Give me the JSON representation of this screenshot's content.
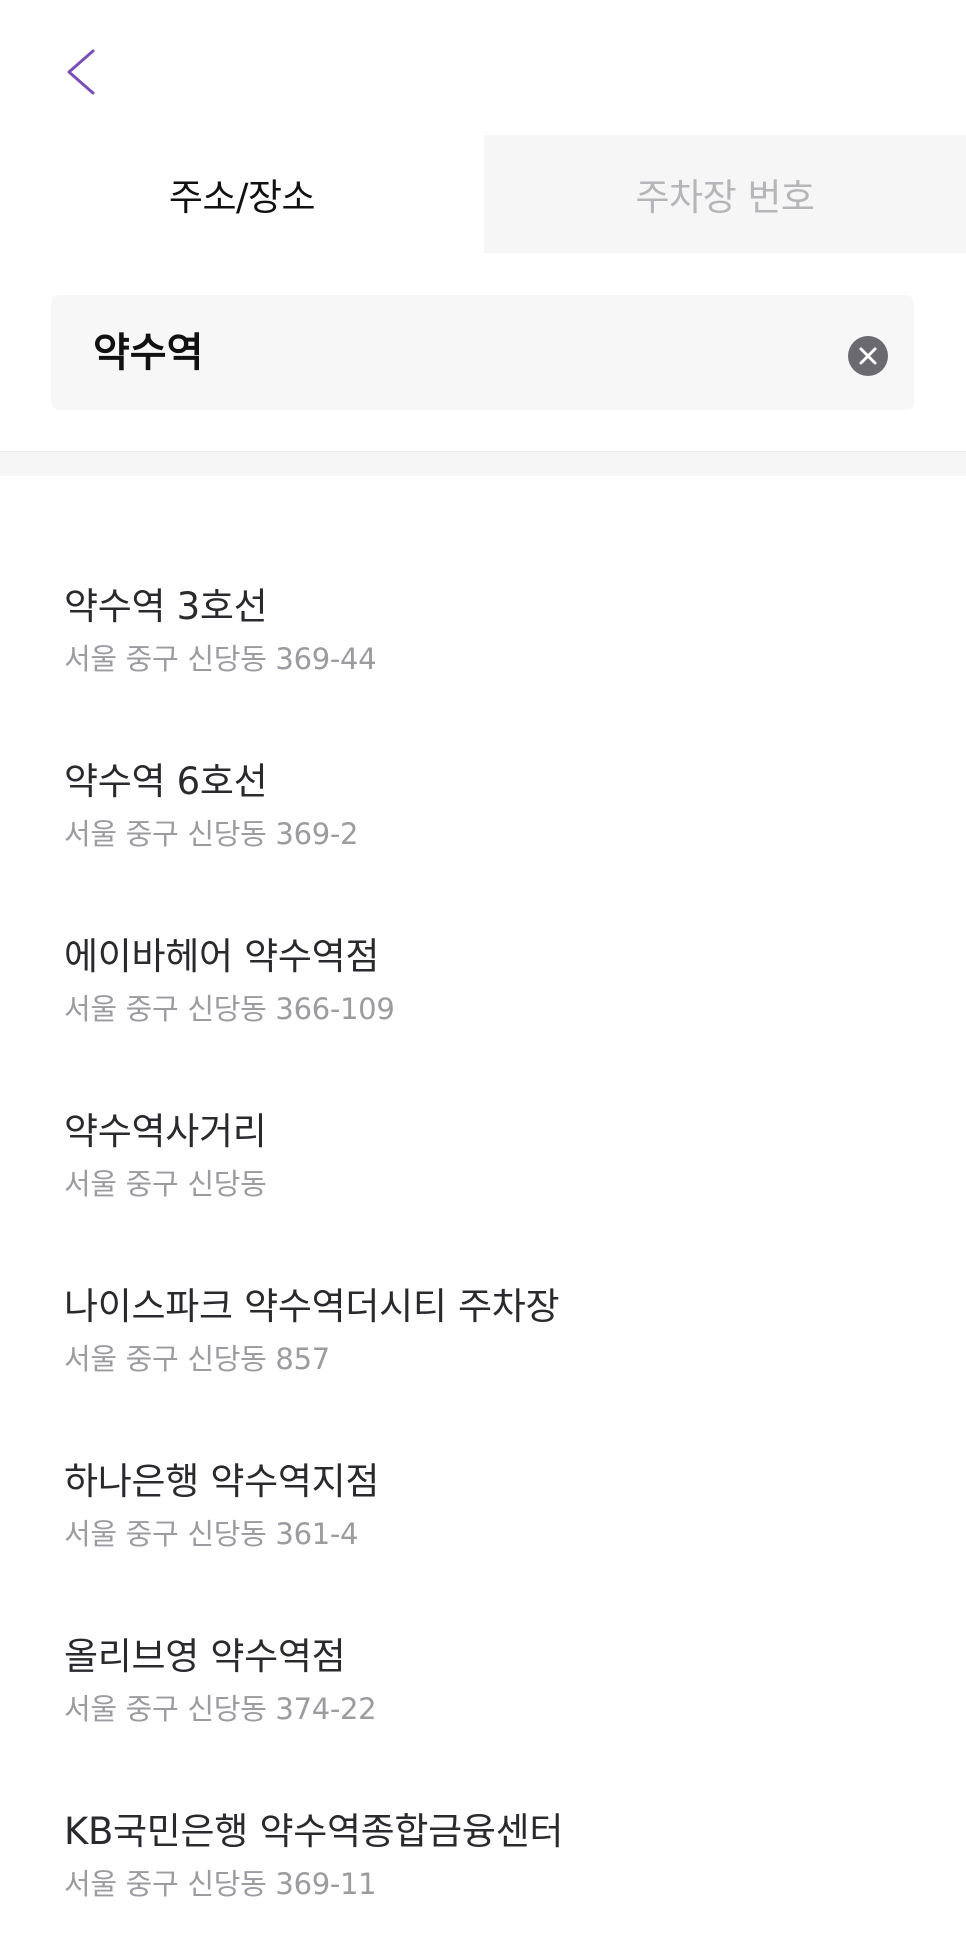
{
  "header": {
    "back_icon": "chevron-left-icon",
    "accent_color": "#7b4fb8"
  },
  "tabs": [
    {
      "label": "주소/장소",
      "active": true
    },
    {
      "label": "주차장 번호",
      "active": false
    }
  ],
  "search": {
    "value": "약수역",
    "placeholder": "",
    "clear_icon": "clear-circle-icon"
  },
  "results": [
    {
      "name": "약수역 3호선",
      "address": "서울 중구 신당동 369-44"
    },
    {
      "name": "약수역 6호선",
      "address": "서울 중구 신당동 369-2"
    },
    {
      "name": "에이바헤어 약수역점",
      "address": "서울 중구 신당동 366-109"
    },
    {
      "name": "약수역사거리",
      "address": "서울 중구 신당동"
    },
    {
      "name": "나이스파크 약수역더시티 주차장",
      "address": "서울 중구 신당동 857"
    },
    {
      "name": "하나은행 약수역지점",
      "address": "서울 중구 신당동 361-4"
    },
    {
      "name": "올리브영 약수역점",
      "address": "서울 중구 신당동 374-22"
    },
    {
      "name": "KB국민은행 약수역종합금융센터",
      "address": "서울 중구 신당동 369-11"
    }
  ]
}
